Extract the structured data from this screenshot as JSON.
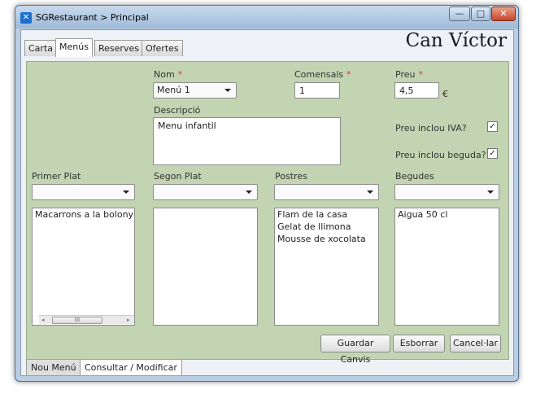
{
  "window": {
    "title": "SGRestaurant > Principal",
    "controls": {
      "minimize": "—",
      "maximize": "□",
      "close": "✕"
    }
  },
  "tabs": [
    "Carta",
    "Menús",
    "Reserves",
    "Ofertes"
  ],
  "brand": "Can Víctor",
  "form": {
    "nom_label": "Nom",
    "nom_value": "Menú 1",
    "comensals_label": "Comensals",
    "comensals_value": "1",
    "preu_label": "Preu",
    "preu_value": "4,5",
    "currency": "€",
    "required_mark": "*",
    "descripcio_label": "Descripció",
    "descripcio_value": "Menu infantil",
    "iva_label": "Preu inclou IVA?",
    "iva_checked": "✓",
    "beguda_label": "Preu inclou beguda?",
    "beguda_checked": "✓"
  },
  "columns": {
    "primer": {
      "label": "Primer Plat",
      "items": [
        "Macarrons a la bolonyesa"
      ]
    },
    "segon": {
      "label": "Segon Plat",
      "items": []
    },
    "postres": {
      "label": "Postres",
      "items": [
        "Flam de la casa",
        "Gelat de llimona",
        "Mousse de xocolata"
      ]
    },
    "begudes": {
      "label": "Begudes",
      "items": [
        "Aigua 50 cl"
      ]
    }
  },
  "scrollbar": {
    "grip": "III"
  },
  "buttons": {
    "save": "Guardar Canvis",
    "delete": "Esborrar",
    "cancel": "Cancel·lar"
  },
  "bottom_tabs": [
    "Nou Menú",
    "Consultar / Modificar"
  ],
  "colors": {
    "panel": "#c2d4b2",
    "required": "#d83c3c"
  }
}
